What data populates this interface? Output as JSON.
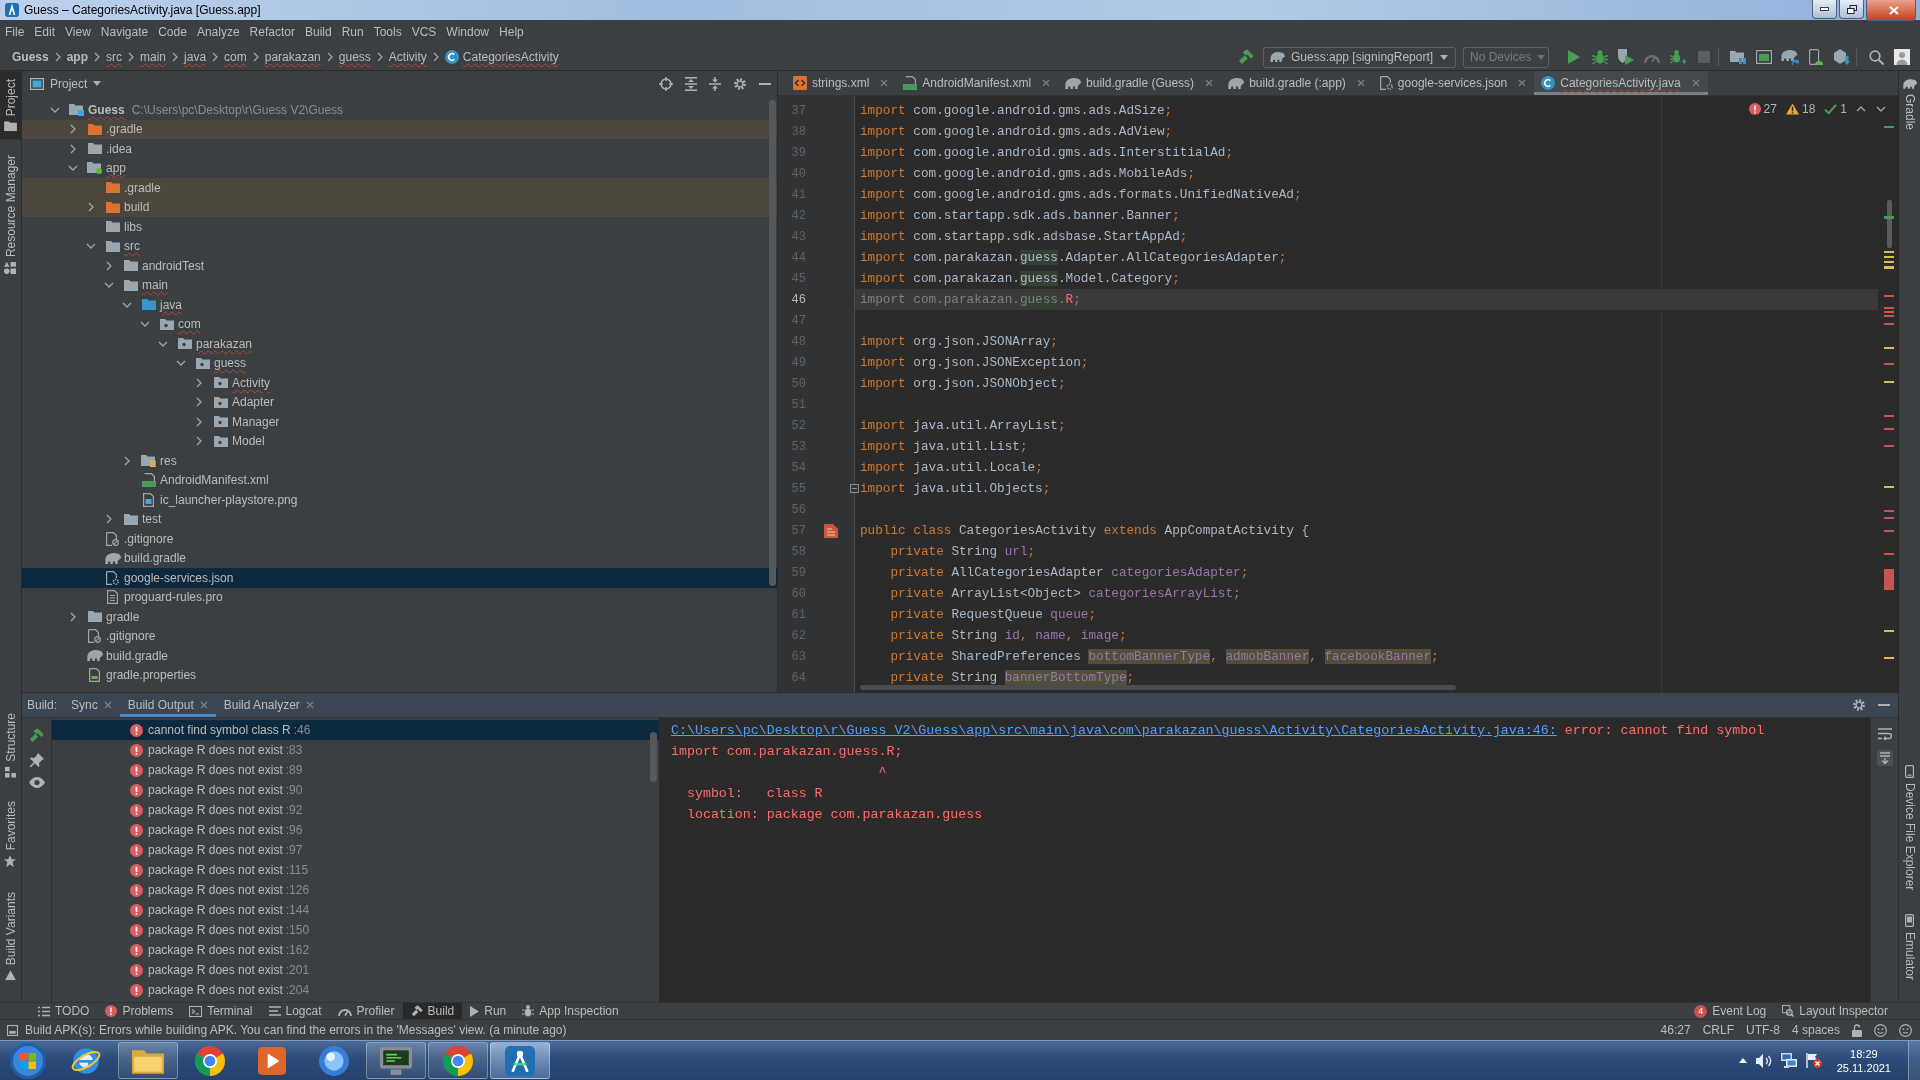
{
  "window": {
    "title": "Guess – CategoriesActivity.java [Guess.app]"
  },
  "menu": [
    "File",
    "Edit",
    "View",
    "Navigate",
    "Code",
    "Analyze",
    "Refactor",
    "Build",
    "Run",
    "Tools",
    "VCS",
    "Window",
    "Help"
  ],
  "breadcrumbs": [
    {
      "label": "Guess",
      "kind": "module",
      "problems": false
    },
    {
      "label": "app",
      "kind": "module",
      "problems": false
    },
    {
      "label": "src",
      "kind": "folder",
      "problems": true
    },
    {
      "label": "main",
      "kind": "folder",
      "problems": true
    },
    {
      "label": "java",
      "kind": "folder",
      "problems": true
    },
    {
      "label": "com",
      "kind": "folder",
      "problems": true
    },
    {
      "label": "parakazan",
      "kind": "folder",
      "problems": true
    },
    {
      "label": "guess",
      "kind": "folder",
      "problems": true
    },
    {
      "label": "Activity",
      "kind": "folder",
      "problems": true
    },
    {
      "label": "CategoriesActivity",
      "kind": "class",
      "problems": true
    }
  ],
  "toolbar": {
    "build_actions": [
      {
        "kind": "make",
        "disabled": false
      }
    ],
    "run_config": "Guess:app [signingReport]",
    "device": {
      "label": "No Devices",
      "disabled": true
    },
    "run_actions": [
      {
        "kind": "run",
        "disabled": false
      },
      {
        "kind": "debug",
        "disabled": false
      },
      {
        "kind": "profile",
        "disabled": false
      },
      {
        "kind": "apply-changes",
        "disabled": true
      },
      {
        "kind": "attach-debugger",
        "disabled": false
      },
      {
        "kind": "stop",
        "disabled": true
      }
    ],
    "tool_actions": [
      {
        "kind": "project-structure",
        "disabled": false
      },
      {
        "kind": "terminal-window",
        "disabled": false
      },
      {
        "kind": "sync",
        "disabled": false
      },
      {
        "kind": "device-manager",
        "disabled": false
      },
      {
        "kind": "sdk-manager",
        "disabled": false
      }
    ],
    "search_actions": [
      {
        "kind": "search",
        "disabled": false
      },
      {
        "kind": "account",
        "disabled": false
      }
    ]
  },
  "left_tool_strip": {
    "top": [
      {
        "label": "Project",
        "kind": "project",
        "selected": true
      },
      {
        "label": "Resource Manager",
        "kind": "resource-manager",
        "selected": false
      }
    ],
    "bottom": [
      {
        "label": "Structure",
        "kind": "structure",
        "selected": false
      },
      {
        "label": "Favorites",
        "kind": "favorites",
        "selected": false
      },
      {
        "label": "Build Variants",
        "kind": "build-variants",
        "selected": false
      }
    ]
  },
  "project_panel": {
    "title": "Project",
    "tree": [
      {
        "label": "Guess",
        "path": "C:\\Users\\pc\\Desktop\\r\\Guess V2\\Guess",
        "kind": "project",
        "expanded": true,
        "selected": false,
        "excluded": false,
        "problems": true,
        "children": [
          {
            "label": ".gradle",
            "kind": "folder",
            "expanded": false,
            "selected": false,
            "excluded": true,
            "problems": false
          },
          {
            "label": ".idea",
            "kind": "folder",
            "expanded": false,
            "selected": false,
            "excluded": false,
            "problems": false
          },
          {
            "label": "app",
            "kind": "module",
            "expanded": true,
            "selected": false,
            "excluded": false,
            "problems": true,
            "children": [
              {
                "label": ".gradle",
                "kind": "folder",
                "selected": false,
                "excluded": true,
                "problems": false
              },
              {
                "label": "build",
                "kind": "folder",
                "expanded": false,
                "selected": false,
                "excluded": true,
                "problems": false
              },
              {
                "label": "libs",
                "kind": "folder",
                "selected": false,
                "excluded": false,
                "problems": false
              },
              {
                "label": "src",
                "kind": "folder",
                "expanded": true,
                "selected": false,
                "excluded": false,
                "problems": true,
                "children": [
                  {
                    "label": "androidTest",
                    "kind": "folder",
                    "expanded": false,
                    "selected": false,
                    "excluded": false,
                    "problems": false
                  },
                  {
                    "label": "main",
                    "kind": "folder",
                    "expanded": true,
                    "selected": false,
                    "excluded": false,
                    "problems": true,
                    "children": [
                      {
                        "label": "java",
                        "kind": "source",
                        "expanded": true,
                        "selected": false,
                        "excluded": false,
                        "problems": true,
                        "children": [
                          {
                            "label": "com",
                            "kind": "package",
                            "expanded": true,
                            "selected": false,
                            "excluded": false,
                            "problems": true,
                            "children": [
                              {
                                "label": "parakazan",
                                "kind": "package",
                                "expanded": true,
                                "selected": false,
                                "excluded": false,
                                "problems": true,
                                "children": [
                                  {
                                    "label": "guess",
                                    "kind": "package",
                                    "expanded": true,
                                    "selected": false,
                                    "excluded": false,
                                    "problems": true,
                                    "children": [
                                      {
                                        "label": "Activity",
                                        "kind": "package",
                                        "expanded": false,
                                        "selected": false,
                                        "excluded": false,
                                        "problems": true
                                      },
                                      {
                                        "label": "Adapter",
                                        "kind": "package",
                                        "expanded": false,
                                        "selected": false,
                                        "excluded": false,
                                        "problems": false
                                      },
                                      {
                                        "label": "Manager",
                                        "kind": "package",
                                        "expanded": false,
                                        "selected": false,
                                        "excluded": false,
                                        "problems": false
                                      },
                                      {
                                        "label": "Model",
                                        "kind": "package",
                                        "expanded": false,
                                        "selected": false,
                                        "excluded": false,
                                        "problems": false
                                      }
                                    ]
                                  }
                                ]
                              }
                            ]
                          }
                        ]
                      },
                      {
                        "label": "res",
                        "kind": "resources",
                        "expanded": false,
                        "selected": false,
                        "excluded": false,
                        "problems": false
                      },
                      {
                        "label": "AndroidManifest.xml",
                        "kind": "manifest",
                        "selected": false,
                        "excluded": false,
                        "problems": false
                      },
                      {
                        "label": "ic_launcher-playstore.png",
                        "kind": "image",
                        "selected": false,
                        "excluded": false,
                        "problems": false
                      }
                    ]
                  },
                  {
                    "label": "test",
                    "kind": "folder",
                    "expanded": false,
                    "selected": false,
                    "excluded": false,
                    "problems": false
                  }
                ]
              },
              {
                "label": ".gitignore",
                "kind": "ignore",
                "selected": false,
                "excluded": false,
                "problems": false
              },
              {
                "label": "build.gradle",
                "kind": "gradle",
                "selected": false,
                "excluded": false,
                "problems": false
              },
              {
                "label": "google-services.json",
                "kind": "json",
                "selected": true,
                "excluded": false,
                "problems": false
              },
              {
                "label": "proguard-rules.pro",
                "kind": "text",
                "selected": false,
                "excluded": false,
                "problems": false
              }
            ]
          },
          {
            "label": "gradle",
            "kind": "folder",
            "expanded": false,
            "selected": false,
            "excluded": false,
            "problems": false
          },
          {
            "label": ".gitignore",
            "kind": "ignore",
            "selected": false,
            "excluded": false,
            "problems": false
          },
          {
            "label": "build.gradle",
            "kind": "gradle",
            "selected": false,
            "excluded": false,
            "problems": false
          },
          {
            "label": "gradle.properties",
            "kind": "properties",
            "selected": false,
            "excluded": false,
            "problems": false
          }
        ]
      }
    ]
  },
  "editor": {
    "tabs": [
      {
        "label": "strings.xml",
        "kind": "xml",
        "selected": false,
        "problems": false
      },
      {
        "label": "AndroidManifest.xml",
        "kind": "manifest",
        "selected": false,
        "problems": false
      },
      {
        "label": "build.gradle (Guess)",
        "kind": "gradle",
        "selected": false,
        "problems": false
      },
      {
        "label": "build.gradle (:app)",
        "kind": "gradle",
        "selected": false,
        "problems": false
      },
      {
        "label": "google-services.json",
        "kind": "json",
        "selected": false,
        "problems": false
      },
      {
        "label": "CategoriesActivity.java",
        "kind": "class",
        "selected": true,
        "problems": true
      }
    ],
    "inspections": {
      "errors": "27",
      "warnings": "18",
      "weak_warnings": "1"
    },
    "lines": [
      {
        "number": "37",
        "current": false,
        "tokens": [
          {
            "kind": "keyword",
            "text": "import"
          },
          {
            "kind": "plain",
            "text": " com.google.android.gms.ads.AdSize"
          },
          {
            "kind": "punct",
            "text": ";"
          }
        ]
      },
      {
        "number": "38",
        "current": false,
        "tokens": [
          {
            "kind": "keyword",
            "text": "import"
          },
          {
            "kind": "plain",
            "text": " com.google.android.gms.ads.AdView"
          },
          {
            "kind": "punct",
            "text": ";"
          }
        ]
      },
      {
        "number": "39",
        "current": false,
        "tokens": [
          {
            "kind": "keyword",
            "text": "import"
          },
          {
            "kind": "plain",
            "text": " com.google.android.gms.ads.InterstitialAd"
          },
          {
            "kind": "punct",
            "text": ";"
          }
        ]
      },
      {
        "number": "40",
        "current": false,
        "tokens": [
          {
            "kind": "keyword",
            "text": "import"
          },
          {
            "kind": "plain",
            "text": " com.google.android.gms.ads.MobileAds"
          },
          {
            "kind": "punct",
            "text": ";"
          }
        ]
      },
      {
        "number": "41",
        "current": false,
        "tokens": [
          {
            "kind": "keyword",
            "text": "import"
          },
          {
            "kind": "plain",
            "text": " com.google.android.gms.ads.formats.UnifiedNativeAd"
          },
          {
            "kind": "punct",
            "text": ";"
          }
        ]
      },
      {
        "number": "42",
        "current": false,
        "tokens": [
          {
            "kind": "keyword",
            "text": "import"
          },
          {
            "kind": "plain",
            "text": " com.startapp.sdk.ads.banner.Banner"
          },
          {
            "kind": "punct",
            "text": ";"
          }
        ]
      },
      {
        "number": "43",
        "current": false,
        "tokens": [
          {
            "kind": "keyword",
            "text": "import"
          },
          {
            "kind": "plain",
            "text": " com.startapp.sdk.adsbase.StartAppAd"
          },
          {
            "kind": "punct",
            "text": ";"
          }
        ]
      },
      {
        "number": "44",
        "current": false,
        "tokens": [
          {
            "kind": "keyword",
            "text": "import"
          },
          {
            "kind": "plain",
            "text": " com.parakazan."
          },
          {
            "kind": "match",
            "text": "guess"
          },
          {
            "kind": "plain",
            "text": ".Adapter.AllCategoriesAdapter"
          },
          {
            "kind": "punct",
            "text": ";"
          }
        ]
      },
      {
        "number": "45",
        "current": false,
        "tokens": [
          {
            "kind": "keyword",
            "text": "import"
          },
          {
            "kind": "plain",
            "text": " com.parakazan."
          },
          {
            "kind": "match",
            "text": "guess"
          },
          {
            "kind": "plain",
            "text": ".Model.Category"
          },
          {
            "kind": "punct",
            "text": ";"
          }
        ]
      },
      {
        "number": "46",
        "current": true,
        "tokens": [
          {
            "kind": "unused",
            "text": "import com.parakazan."
          },
          {
            "kind": "unused-match",
            "text": "guess"
          },
          {
            "kind": "unused",
            "text": "."
          },
          {
            "kind": "error",
            "text": "R"
          },
          {
            "kind": "unused",
            "text": ";"
          }
        ]
      },
      {
        "number": "47",
        "current": false
      },
      {
        "number": "48",
        "current": false,
        "tokens": [
          {
            "kind": "keyword",
            "text": "import"
          },
          {
            "kind": "plain",
            "text": " org.json.JSONArray"
          },
          {
            "kind": "punct",
            "text": ";"
          }
        ]
      },
      {
        "number": "49",
        "current": false,
        "tokens": [
          {
            "kind": "keyword",
            "text": "import"
          },
          {
            "kind": "plain",
            "text": " org.json.JSONException"
          },
          {
            "kind": "punct",
            "text": ";"
          }
        ]
      },
      {
        "number": "50",
        "current": false,
        "tokens": [
          {
            "kind": "keyword",
            "text": "import"
          },
          {
            "kind": "plain",
            "text": " org.json.JSONObject"
          },
          {
            "kind": "punct",
            "text": ";"
          }
        ]
      },
      {
        "number": "51",
        "current": false
      },
      {
        "number": "52",
        "current": false,
        "tokens": [
          {
            "kind": "keyword",
            "text": "import"
          },
          {
            "kind": "plain",
            "text": " java.util.ArrayList"
          },
          {
            "kind": "punct",
            "text": ";"
          }
        ]
      },
      {
        "number": "53",
        "current": false,
        "tokens": [
          {
            "kind": "keyword",
            "text": "import"
          },
          {
            "kind": "plain",
            "text": " java.util.List"
          },
          {
            "kind": "punct",
            "text": ";"
          }
        ]
      },
      {
        "number": "54",
        "current": false,
        "tokens": [
          {
            "kind": "keyword",
            "text": "import"
          },
          {
            "kind": "plain",
            "text": " java.util.Locale"
          },
          {
            "kind": "punct",
            "text": ";"
          }
        ]
      },
      {
        "number": "55",
        "current": false,
        "gutter": {
          "kind": "fold"
        },
        "tokens": [
          {
            "kind": "keyword",
            "text": "import"
          },
          {
            "kind": "plain",
            "text": " java.util.Objects"
          },
          {
            "kind": "punct",
            "text": ";"
          }
        ]
      },
      {
        "number": "56",
        "current": false
      },
      {
        "number": "57",
        "current": false,
        "gutter": {
          "kind": "layout"
        },
        "tokens": [
          {
            "kind": "keyword",
            "text": "public class"
          },
          {
            "kind": "plain",
            "text": " CategoriesActivity "
          },
          {
            "kind": "keyword",
            "text": "extends"
          },
          {
            "kind": "plain",
            "text": " AppCompatActivity {"
          }
        ]
      },
      {
        "number": "58",
        "current": false,
        "tokens": [
          {
            "kind": "keyword",
            "text": "    private"
          },
          {
            "kind": "plain",
            "text": " String "
          },
          {
            "kind": "field",
            "text": "url"
          },
          {
            "kind": "punct",
            "text": ";"
          }
        ]
      },
      {
        "number": "59",
        "current": false,
        "tokens": [
          {
            "kind": "keyword",
            "text": "    private"
          },
          {
            "kind": "plain",
            "text": " AllCategoriesAdapter "
          },
          {
            "kind": "field",
            "text": "categoriesAdapter"
          },
          {
            "kind": "punct",
            "text": ";"
          }
        ]
      },
      {
        "number": "60",
        "current": false,
        "tokens": [
          {
            "kind": "keyword",
            "text": "    private"
          },
          {
            "kind": "plain",
            "text": " ArrayList<Object> "
          },
          {
            "kind": "field",
            "text": "categoriesArrayList"
          },
          {
            "kind": "punct",
            "text": ";"
          }
        ]
      },
      {
        "number": "61",
        "current": false,
        "tokens": [
          {
            "kind": "keyword",
            "text": "    private"
          },
          {
            "kind": "plain",
            "text": " RequestQueue "
          },
          {
            "kind": "field",
            "text": "queue"
          },
          {
            "kind": "punct",
            "text": ";"
          }
        ]
      },
      {
        "number": "62",
        "current": false,
        "tokens": [
          {
            "kind": "keyword",
            "text": "    private"
          },
          {
            "kind": "plain",
            "text": " String "
          },
          {
            "kind": "field",
            "text": "id"
          },
          {
            "kind": "punct",
            "text": ", "
          },
          {
            "kind": "field",
            "text": "name"
          },
          {
            "kind": "punct",
            "text": ", "
          },
          {
            "kind": "field",
            "text": "image"
          },
          {
            "kind": "punct",
            "text": ";"
          }
        ]
      },
      {
        "number": "63",
        "current": false,
        "tokens": [
          {
            "kind": "keyword",
            "text": "    private"
          },
          {
            "kind": "plain",
            "text": " SharedPreferences "
          },
          {
            "kind": "warning-field",
            "text": "bottomBannerType"
          },
          {
            "kind": "punct",
            "text": ", "
          },
          {
            "kind": "warning-field",
            "text": "admobBanner"
          },
          {
            "kind": "punct",
            "text": ", "
          },
          {
            "kind": "warning-field",
            "text": "facebookBanner"
          },
          {
            "kind": "punct",
            "text": ";"
          }
        ]
      },
      {
        "number": "64",
        "current": false,
        "tokens": [
          {
            "kind": "keyword",
            "text": "    private"
          },
          {
            "kind": "plain",
            "text": " String "
          },
          {
            "kind": "warning-field",
            "text": "bannerBottomType"
          },
          {
            "kind": "punct",
            "text": ";"
          }
        ]
      }
    ]
  },
  "right_tool_strip": {
    "top": [
      {
        "label": "Gradle",
        "kind": "gradle",
        "selected": false
      }
    ],
    "bottom": [
      {
        "label": "Device File Explorer",
        "kind": "device-file-explorer",
        "selected": false
      },
      {
        "label": "Emulator",
        "kind": "emulator",
        "selected": false
      }
    ]
  },
  "build_panel": {
    "title": "Build:",
    "tabs": [
      {
        "label": "Sync",
        "selected": false
      },
      {
        "label": "Build Output",
        "selected": true
      },
      {
        "label": "Build Analyzer",
        "selected": false
      }
    ],
    "messages": [
      {
        "text": "cannot find symbol class R",
        "line": ":46",
        "selected": true
      },
      {
        "text": "package R does not exist",
        "line": ":83",
        "selected": false
      },
      {
        "text": "package R does not exist",
        "line": ":89",
        "selected": false
      },
      {
        "text": "package R does not exist",
        "line": ":90",
        "selected": false
      },
      {
        "text": "package R does not exist",
        "line": ":92",
        "selected": false
      },
      {
        "text": "package R does not exist",
        "line": ":96",
        "selected": false
      },
      {
        "text": "package R does not exist",
        "line": ":97",
        "selected": false
      },
      {
        "text": "package R does not exist",
        "line": ":115",
        "selected": false
      },
      {
        "text": "package R does not exist",
        "line": ":126",
        "selected": false
      },
      {
        "text": "package R does not exist",
        "line": ":144",
        "selected": false
      },
      {
        "text": "package R does not exist",
        "line": ":150",
        "selected": false
      },
      {
        "text": "package R does not exist",
        "line": ":162",
        "selected": false
      },
      {
        "text": "package R does not exist",
        "line": ":201",
        "selected": false
      },
      {
        "text": "package R does not exist",
        "line": ":204",
        "selected": false
      }
    ],
    "console": {
      "path": "C:\\Users\\pc\\Desktop\\r\\Guess V2\\Guess\\app\\src\\main\\java\\com\\parakazan\\guess\\Activity\\CategoriesActivity.java:46:",
      "error": "error: cannot find symbol",
      "lines": [
        {
          "kind": "code",
          "text": "import com.parakazan.guess.R;"
        },
        {
          "kind": "caret",
          "text": "^"
        },
        {
          "kind": "detail",
          "text": "symbol:   class R"
        },
        {
          "kind": "detail",
          "text": "location: package com.parakazan.guess"
        }
      ]
    }
  },
  "tool_window_bar": {
    "left": [
      {
        "label": "TODO",
        "kind": "todo",
        "selected": false
      },
      {
        "label": "Problems",
        "kind": "problems",
        "selected": false
      },
      {
        "label": "Terminal",
        "kind": "terminal",
        "selected": false
      },
      {
        "label": "Logcat",
        "kind": "logcat",
        "selected": false
      },
      {
        "label": "Profiler",
        "kind": "profiler",
        "selected": false
      },
      {
        "label": "Build",
        "kind": "build",
        "selected": true
      },
      {
        "label": "Run",
        "kind": "run",
        "selected": false
      },
      {
        "label": "App Inspection",
        "kind": "app-inspection",
        "selected": false
      }
    ],
    "right": [
      {
        "label": "Event Log",
        "kind": "event-log",
        "badge": "4",
        "selected": false
      },
      {
        "label": "Layout Inspector",
        "kind": "layout-inspector",
        "selected": false
      }
    ]
  },
  "status_bar": {
    "message": "Build APK(s): Errors while building APK. You can find the errors in the 'Messages' view. (a minute ago)",
    "items": [
      "46:27",
      "CRLF",
      "UTF-8",
      "4 spaces"
    ]
  },
  "taskbar": {
    "apps": [
      {
        "kind": "browser-e",
        "running": false,
        "selected": false
      },
      {
        "kind": "folder",
        "running": true,
        "selected": false
      },
      {
        "kind": "browser-ring",
        "running": false,
        "selected": false
      },
      {
        "kind": "player",
        "running": false,
        "selected": false
      },
      {
        "kind": "orb",
        "running": false,
        "selected": false
      },
      {
        "kind": "monitor",
        "running": true,
        "selected": false
      },
      {
        "kind": "browser-ring",
        "running": true,
        "selected": false
      },
      {
        "kind": "studio",
        "running": true,
        "selected": true
      }
    ],
    "time": "18:29",
    "date": "25.11.2021"
  }
}
